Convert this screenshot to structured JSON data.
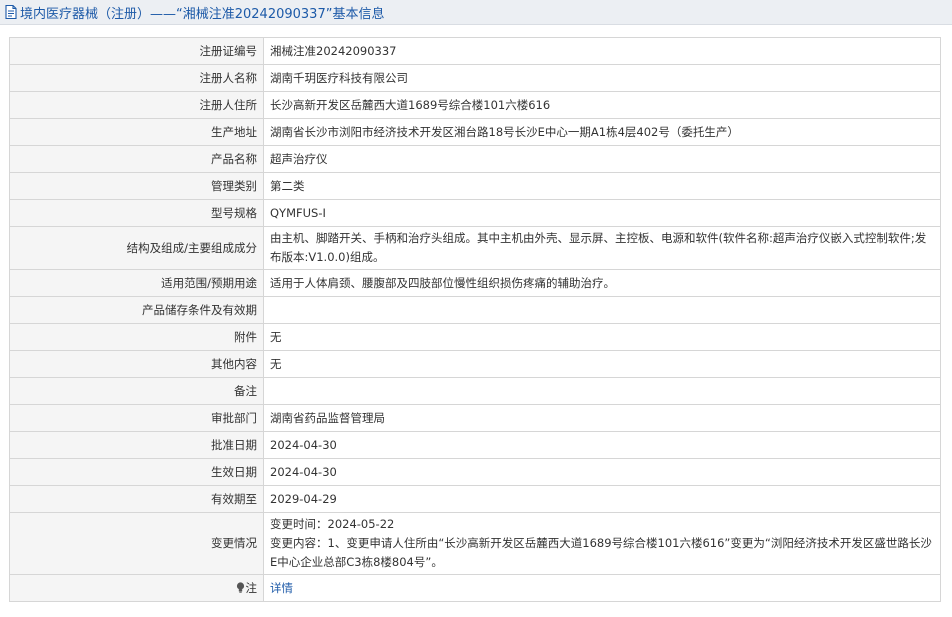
{
  "header": {
    "icon": "document-icon",
    "title": "境内医疗器械（注册）——“湘械注准20242090337”基本信息"
  },
  "rows": [
    {
      "label": "注册证编号",
      "value": "湘械注准20242090337"
    },
    {
      "label": "注册人名称",
      "value": "湖南千玥医疗科技有限公司"
    },
    {
      "label": "注册人住所",
      "value": "长沙高新开发区岳麓西大道1689号综合楼101六楼616"
    },
    {
      "label": "生产地址",
      "value": "湖南省长沙市浏阳市经济技术开发区湘台路18号长沙E中心一期A1栋4层402号（委托生产）"
    },
    {
      "label": "产品名称",
      "value": "超声治疗仪"
    },
    {
      "label": "管理类别",
      "value": "第二类"
    },
    {
      "label": "型号规格",
      "value": "QYMFUS-I"
    },
    {
      "label": "结构及组成/主要组成成分",
      "value": "由主机、脚踏开关、手柄和治疗头组成。其中主机由外壳、显示屏、主控板、电源和软件(软件名称:超声治疗仪嵌入式控制软件;发布版本:V1.0.0)组成。"
    },
    {
      "label": "适用范围/预期用途",
      "value": "适用于人体肩颈、腰腹部及四肢部位慢性组织损伤疼痛的辅助治疗。"
    },
    {
      "label": "产品储存条件及有效期",
      "value": ""
    },
    {
      "label": "附件",
      "value": "无"
    },
    {
      "label": "其他内容",
      "value": "无"
    },
    {
      "label": "备注",
      "value": ""
    },
    {
      "label": "审批部门",
      "value": "湖南省药品监督管理局"
    },
    {
      "label": "批准日期",
      "value": "2024-04-30"
    },
    {
      "label": "生效日期",
      "value": "2024-04-30"
    },
    {
      "label": "有效期至",
      "value": "2029-04-29"
    }
  ],
  "change": {
    "label": "变更情况",
    "time": "变更时间：2024-05-22",
    "content": "变更内容：1、变更申请人住所由“长沙高新开发区岳麓西大道1689号综合楼101六楼616”变更为“浏阳经济技术开发区盛世路长沙E中心企业总部C3栋8楼804号”。"
  },
  "note": {
    "icon": "lightbulb-icon",
    "label": "注",
    "link": "详情"
  },
  "colors": {
    "link": "#1d5aa8",
    "header_bg": "#eceff3",
    "label_bg": "#f5f5f5",
    "border": "#d6d6d6"
  }
}
